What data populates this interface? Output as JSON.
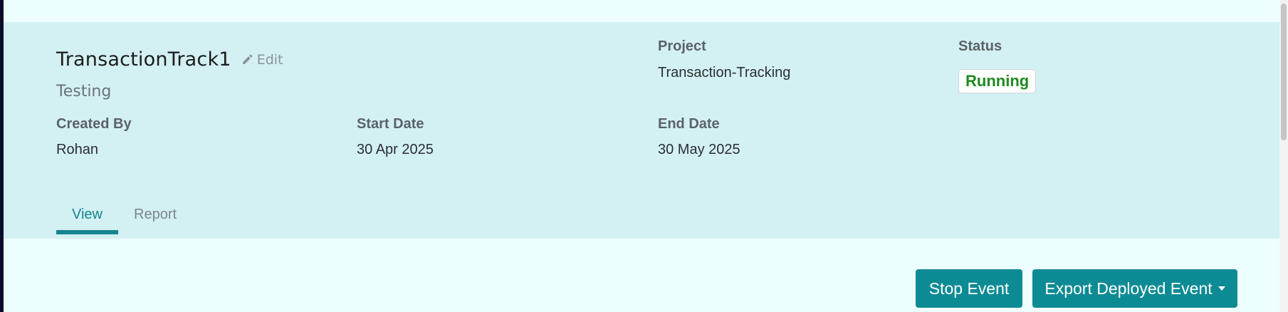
{
  "event": {
    "title": "TransactionTrack1",
    "edit_label": "Edit",
    "environment": "Testing"
  },
  "fields": {
    "project_label": "Project",
    "project_value": "Transaction-Tracking",
    "status_label": "Status",
    "status_value": "Running",
    "created_by_label": "Created By",
    "created_by_value": "Rohan",
    "start_date_label": "Start Date",
    "start_date_value": "30 Apr 2025",
    "end_date_label": "End Date",
    "end_date_value": "30 May 2025"
  },
  "tabs": [
    {
      "label": "View",
      "active": true
    },
    {
      "label": "Report",
      "active": false
    }
  ],
  "actions": {
    "stop_label": "Stop Event",
    "export_label": "Export Deployed Event"
  },
  "icons": {
    "edit": "pencil-icon",
    "export_dropdown": "caret-down-icon"
  },
  "colors": {
    "page_background": "#edfefe",
    "header_background": "#d3f0f3",
    "accent": "#0d8b94",
    "active_tab": "#16858f",
    "status_running": "#1f8a1f"
  }
}
